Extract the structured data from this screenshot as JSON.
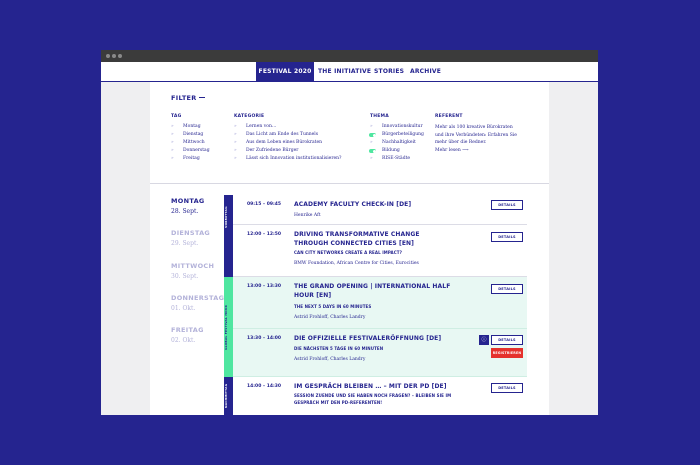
{
  "nav": {
    "items": [
      {
        "label": "FESTIVAL 2020",
        "active": true
      },
      {
        "label": "THE INITIATIVE",
        "active": false
      },
      {
        "label": "STORIES",
        "active": false
      },
      {
        "label": "ARCHIVE",
        "active": false
      }
    ]
  },
  "filter": {
    "title": "FILTER",
    "tag": {
      "heading": "TAG",
      "options": [
        "Montag",
        "Dienstag",
        "Mittwoch",
        "Donnerstag",
        "Freitag"
      ]
    },
    "kategorie": {
      "heading": "KATEGORIE",
      "options": [
        "Lernen von…",
        "Das Licht am Ende des Tunnels",
        "Aus dem Leben eines Bürokraten",
        "Der Zufriedene Bürger",
        "Lässt sich Innovation institutionalisieren?"
      ]
    },
    "thema": {
      "heading": "THEMA",
      "options": [
        {
          "label": "Innovationskultur",
          "active": false
        },
        {
          "label": "Bürgerbeteiligung",
          "active": true
        },
        {
          "label": "Nachhaltigkeit",
          "active": false
        },
        {
          "label": "Bildung",
          "active": true
        },
        {
          "label": "RISE-Städte",
          "active": false
        }
      ]
    },
    "referent": {
      "heading": "REFERENT",
      "text": "Mehr als 100 kreative Bürokraten und ihre Verbündeten: Erfahren Sie mehr über die Redner.",
      "link": "Mehr lesen ⟶"
    }
  },
  "days": [
    {
      "name": "MONTAG",
      "date": "28. Sept.",
      "active": true
    },
    {
      "name": "DIENSTAG",
      "date": "29. Sept.",
      "active": false
    },
    {
      "name": "MITTWOCH",
      "date": "30. Sept.",
      "active": false
    },
    {
      "name": "DONNERSTAG",
      "date": "01. Okt.",
      "active": false
    },
    {
      "name": "FREITAG",
      "date": "02. Okt.",
      "active": false
    }
  ],
  "bands": [
    {
      "label": "VORMITTAG",
      "color": "#25248f",
      "text_color": "#ffffff"
    },
    {
      "label": "GLOBAL FESTIVAL HOUR",
      "color": "#4fe6a0",
      "text_color": "#25248f"
    },
    {
      "label": "NACHMITTAG",
      "color": "#25248f",
      "text_color": "#ffffff"
    }
  ],
  "events": [
    {
      "time": "09:15 – 09:45",
      "title": "ACADEMY FACULTY CHECK-IN [DE]",
      "subtitle": "",
      "speakers": "Henrike Aft",
      "button": "DETAILS"
    },
    {
      "time": "12:00 – 12:50",
      "title": "DRIVING TRANSFORMATIVE CHANGE THROUGH CONNECTED CITIES [EN]",
      "subtitle": "CAN CITY NETWORKS CREATE A REAL IMPACT?",
      "speakers": "BMW Foundation,  African Centre for Cities,  Eurocities",
      "button": "DETAILS"
    },
    {
      "time": "13:00 – 13:30",
      "title": "THE GRAND OPENING | INTERNATIONAL HALF HOUR [EN]",
      "subtitle": "THE NEXT 5 DAYS IN 60 MINUTES",
      "speakers": "Astrid Frohloff,  Charles Landry",
      "button": "DETAILS"
    },
    {
      "time": "13:30 – 14:00",
      "title": "DIE OFFIZIELLE FESTIVALERÖFFNUNG [DE]",
      "subtitle": "DIE NÄCHSTEN 5 TAGE IN 60 MINUTEN",
      "speakers": "Astrid Frohloff,  Charles Landry",
      "button": "DETAILS",
      "register": "REGISTRIEREN"
    },
    {
      "time": "14:00 – 14:30",
      "title": "IM GESPRÄCH BLEIBEN … – MIT DER PD [DE]",
      "subtitle": "SESSION ZUENDE UND SIE HABEN NOCH FRAGEN? – BLEIBEN SIE IM GESPRÄCH MIT DEN PD-REFERENTEN!",
      "speakers": "",
      "button": "DETAILS"
    }
  ],
  "colors": {
    "brand": "#25248f",
    "accent": "#4fe6a0",
    "alert": "#e5322d"
  }
}
